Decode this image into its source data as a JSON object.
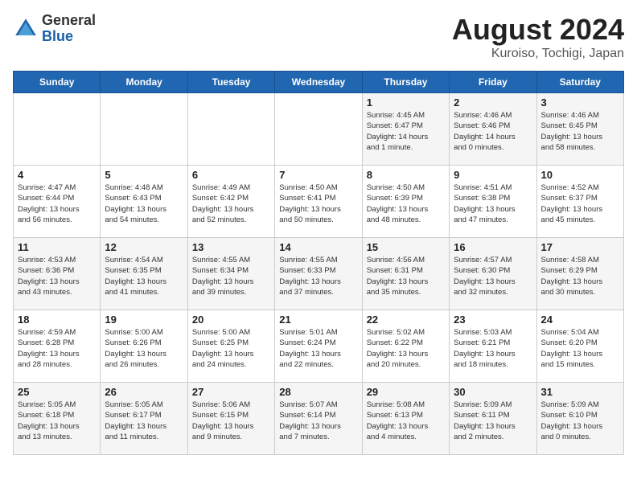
{
  "header": {
    "logo_general": "General",
    "logo_blue": "Blue",
    "title": "August 2024",
    "subtitle": "Kuroiso, Tochigi, Japan"
  },
  "days_of_week": [
    "Sunday",
    "Monday",
    "Tuesday",
    "Wednesday",
    "Thursday",
    "Friday",
    "Saturday"
  ],
  "weeks": [
    [
      {
        "day": "",
        "content": ""
      },
      {
        "day": "",
        "content": ""
      },
      {
        "day": "",
        "content": ""
      },
      {
        "day": "",
        "content": ""
      },
      {
        "day": "1",
        "content": "Sunrise: 4:45 AM\nSunset: 6:47 PM\nDaylight: 14 hours\nand 1 minute."
      },
      {
        "day": "2",
        "content": "Sunrise: 4:46 AM\nSunset: 6:46 PM\nDaylight: 14 hours\nand 0 minutes."
      },
      {
        "day": "3",
        "content": "Sunrise: 4:46 AM\nSunset: 6:45 PM\nDaylight: 13 hours\nand 58 minutes."
      }
    ],
    [
      {
        "day": "4",
        "content": "Sunrise: 4:47 AM\nSunset: 6:44 PM\nDaylight: 13 hours\nand 56 minutes."
      },
      {
        "day": "5",
        "content": "Sunrise: 4:48 AM\nSunset: 6:43 PM\nDaylight: 13 hours\nand 54 minutes."
      },
      {
        "day": "6",
        "content": "Sunrise: 4:49 AM\nSunset: 6:42 PM\nDaylight: 13 hours\nand 52 minutes."
      },
      {
        "day": "7",
        "content": "Sunrise: 4:50 AM\nSunset: 6:41 PM\nDaylight: 13 hours\nand 50 minutes."
      },
      {
        "day": "8",
        "content": "Sunrise: 4:50 AM\nSunset: 6:39 PM\nDaylight: 13 hours\nand 48 minutes."
      },
      {
        "day": "9",
        "content": "Sunrise: 4:51 AM\nSunset: 6:38 PM\nDaylight: 13 hours\nand 47 minutes."
      },
      {
        "day": "10",
        "content": "Sunrise: 4:52 AM\nSunset: 6:37 PM\nDaylight: 13 hours\nand 45 minutes."
      }
    ],
    [
      {
        "day": "11",
        "content": "Sunrise: 4:53 AM\nSunset: 6:36 PM\nDaylight: 13 hours\nand 43 minutes."
      },
      {
        "day": "12",
        "content": "Sunrise: 4:54 AM\nSunset: 6:35 PM\nDaylight: 13 hours\nand 41 minutes."
      },
      {
        "day": "13",
        "content": "Sunrise: 4:55 AM\nSunset: 6:34 PM\nDaylight: 13 hours\nand 39 minutes."
      },
      {
        "day": "14",
        "content": "Sunrise: 4:55 AM\nSunset: 6:33 PM\nDaylight: 13 hours\nand 37 minutes."
      },
      {
        "day": "15",
        "content": "Sunrise: 4:56 AM\nSunset: 6:31 PM\nDaylight: 13 hours\nand 35 minutes."
      },
      {
        "day": "16",
        "content": "Sunrise: 4:57 AM\nSunset: 6:30 PM\nDaylight: 13 hours\nand 32 minutes."
      },
      {
        "day": "17",
        "content": "Sunrise: 4:58 AM\nSunset: 6:29 PM\nDaylight: 13 hours\nand 30 minutes."
      }
    ],
    [
      {
        "day": "18",
        "content": "Sunrise: 4:59 AM\nSunset: 6:28 PM\nDaylight: 13 hours\nand 28 minutes."
      },
      {
        "day": "19",
        "content": "Sunrise: 5:00 AM\nSunset: 6:26 PM\nDaylight: 13 hours\nand 26 minutes."
      },
      {
        "day": "20",
        "content": "Sunrise: 5:00 AM\nSunset: 6:25 PM\nDaylight: 13 hours\nand 24 minutes."
      },
      {
        "day": "21",
        "content": "Sunrise: 5:01 AM\nSunset: 6:24 PM\nDaylight: 13 hours\nand 22 minutes."
      },
      {
        "day": "22",
        "content": "Sunrise: 5:02 AM\nSunset: 6:22 PM\nDaylight: 13 hours\nand 20 minutes."
      },
      {
        "day": "23",
        "content": "Sunrise: 5:03 AM\nSunset: 6:21 PM\nDaylight: 13 hours\nand 18 minutes."
      },
      {
        "day": "24",
        "content": "Sunrise: 5:04 AM\nSunset: 6:20 PM\nDaylight: 13 hours\nand 15 minutes."
      }
    ],
    [
      {
        "day": "25",
        "content": "Sunrise: 5:05 AM\nSunset: 6:18 PM\nDaylight: 13 hours\nand 13 minutes."
      },
      {
        "day": "26",
        "content": "Sunrise: 5:05 AM\nSunset: 6:17 PM\nDaylight: 13 hours\nand 11 minutes."
      },
      {
        "day": "27",
        "content": "Sunrise: 5:06 AM\nSunset: 6:15 PM\nDaylight: 13 hours\nand 9 minutes."
      },
      {
        "day": "28",
        "content": "Sunrise: 5:07 AM\nSunset: 6:14 PM\nDaylight: 13 hours\nand 7 minutes."
      },
      {
        "day": "29",
        "content": "Sunrise: 5:08 AM\nSunset: 6:13 PM\nDaylight: 13 hours\nand 4 minutes."
      },
      {
        "day": "30",
        "content": "Sunrise: 5:09 AM\nSunset: 6:11 PM\nDaylight: 13 hours\nand 2 minutes."
      },
      {
        "day": "31",
        "content": "Sunrise: 5:09 AM\nSunset: 6:10 PM\nDaylight: 13 hours\nand 0 minutes."
      }
    ]
  ]
}
